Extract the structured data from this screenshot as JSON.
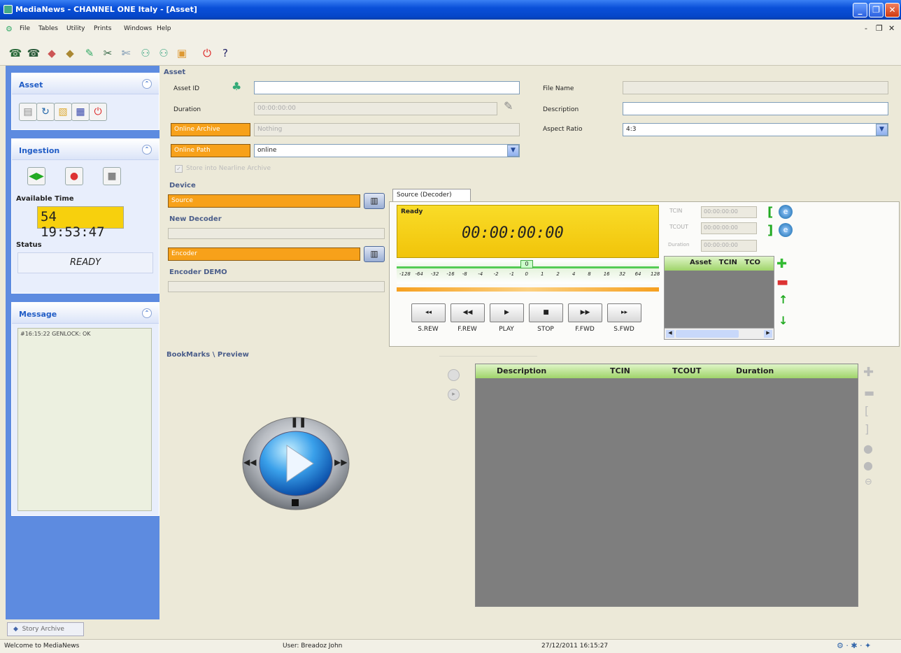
{
  "window": {
    "title": "MediaNews - CHANNEL ONE Italy - [Asset]"
  },
  "menu": [
    "File",
    "Tables",
    "Utility",
    "Prints",
    "Windows",
    "Help"
  ],
  "left": {
    "asset_title": "Asset",
    "ingestion_title": "Ingestion",
    "available_time_label": "Available Time",
    "available_time_value": "54 19:53:47",
    "status_label": "Status",
    "status_value": "READY",
    "message_title": "Message",
    "message_text": "#16:15:22 GENLOCK: OK"
  },
  "asset": {
    "section": "Asset",
    "asset_id_label": "Asset ID",
    "asset_id_value": "",
    "duration_label": "Duration",
    "duration_value": "00:00:00:00",
    "online_archive_label": "Online Archive",
    "online_archive_value": "Nothing",
    "online_path_label": "Online Path",
    "online_path_value": "online",
    "store_label": "Store into Nearline Archive",
    "file_name_label": "File Name",
    "file_name_value": "",
    "description_label": "Description",
    "description_value": "",
    "aspect_ratio_label": "Aspect Ratio",
    "aspect_ratio_value": "4:3"
  },
  "device": {
    "section": "Device",
    "source_label": "Source",
    "decoder_name": "New Decoder",
    "encoder_label": "Encoder",
    "encoder_name": "Encoder DEMO"
  },
  "decoder": {
    "tab": "Source (Decoder)",
    "state": "Ready",
    "timecode": "00:00:00:00",
    "tcin_label": "TCIN",
    "tcin_value": "00:00:00:00",
    "tcout_label": "TCOUT",
    "tcout_value": "00:00:00:00",
    "duration_label": "Duration",
    "duration_value": "00:00:00:00",
    "jog_value": "0",
    "scale": [
      "-128",
      "-64",
      "-32",
      "-16",
      "-8",
      "-4",
      "-2",
      "-1",
      "0",
      "1",
      "2",
      "4",
      "8",
      "16",
      "32",
      "64",
      "128"
    ],
    "transport": [
      "S.REW",
      "F.REW",
      "PLAY",
      "STOP",
      "F.FWD",
      "S.FWD"
    ],
    "list_headers": [
      "Asset",
      "TCIN",
      "TCO"
    ]
  },
  "bookmarks": {
    "section": "BookMarks \\ Preview",
    "headers": [
      "Description",
      "TCIN",
      "TCOUT",
      "Duration"
    ]
  },
  "taskbar": {
    "tab": "Story Archive"
  },
  "status": {
    "welcome": "Welcome to MediaNews",
    "user": "User: Breadoz John",
    "datetime": "27/12/2011 16:15:27"
  }
}
